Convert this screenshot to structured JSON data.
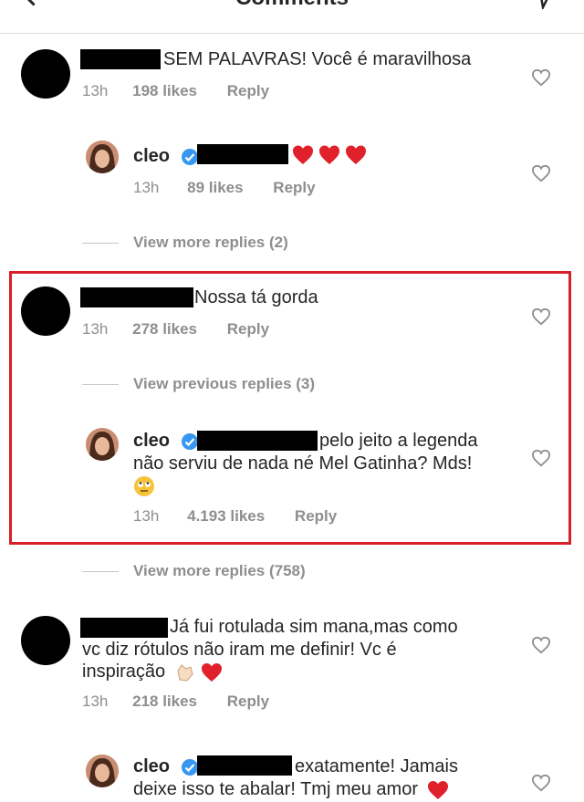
{
  "header": {
    "title": "Comments"
  },
  "comments": [
    {
      "text": "SEM PALAVRAS! Você é maravilhosa",
      "time": "13h",
      "likes": "198 likes",
      "reply": "Reply",
      "replies": [
        {
          "user": "cleo",
          "text": "",
          "time": "13h",
          "likes": "89 likes",
          "reply": "Reply"
        }
      ],
      "more": "View more replies (2)"
    },
    {
      "text": "Nossa tá gorda",
      "time": "13h",
      "likes": "278 likes",
      "reply": "Reply",
      "previous": "View previous replies (3)",
      "replies": [
        {
          "user": "cleo",
          "line1": "pelo jeito a legenda",
          "line2": "não serviu de nada né Mel Gatinha? Mds!",
          "time": "13h",
          "likes": "4.193 likes",
          "reply": "Reply"
        }
      ],
      "more": "View more replies (758)"
    },
    {
      "line1": "Já fui rotulada sim mana,mas como",
      "line2": "vc diz rótulos não iram me definir! Vc é",
      "line3": "inspiração",
      "time": "13h",
      "likes": "218 likes",
      "reply": "Reply",
      "replies": [
        {
          "user": "cleo",
          "line1": "exatamente! Jamais",
          "line2": "deixe isso te abalar! Tmj meu amor"
        }
      ]
    }
  ],
  "colors": {
    "highlight": "#d71f2a",
    "heart": "#e0202a",
    "verified": "#3897f0",
    "muted": "#8e8e8e"
  }
}
